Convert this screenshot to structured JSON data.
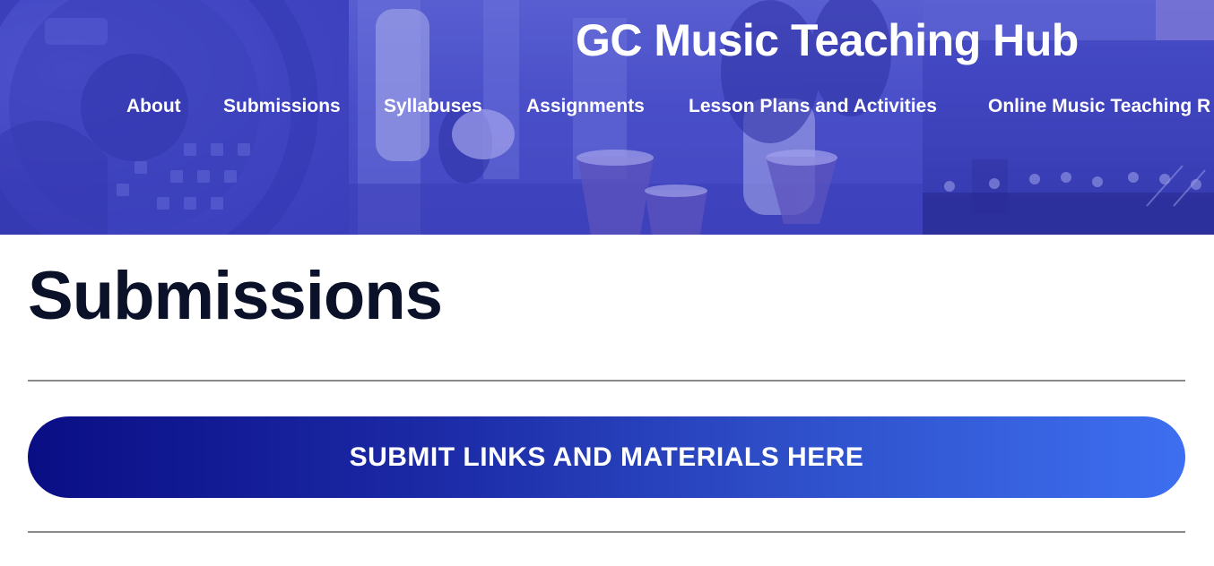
{
  "header": {
    "site_title": "GC Music Teaching Hub",
    "nav": [
      {
        "label": "About"
      },
      {
        "label": "Submissions"
      },
      {
        "label": "Syllabuses"
      },
      {
        "label": "Assignments"
      },
      {
        "label": "Lesson Plans and Activities"
      },
      {
        "label": "Online Music Teaching R"
      }
    ],
    "banner_color": "#4b4fc4"
  },
  "main": {
    "page_title": "Submissions",
    "cta_label": "SUBMIT LINKS AND MATERIALS HERE",
    "cta_gradient": [
      "#0a0e85",
      "#3d6ff0"
    ],
    "title_color": "#0a1128"
  }
}
